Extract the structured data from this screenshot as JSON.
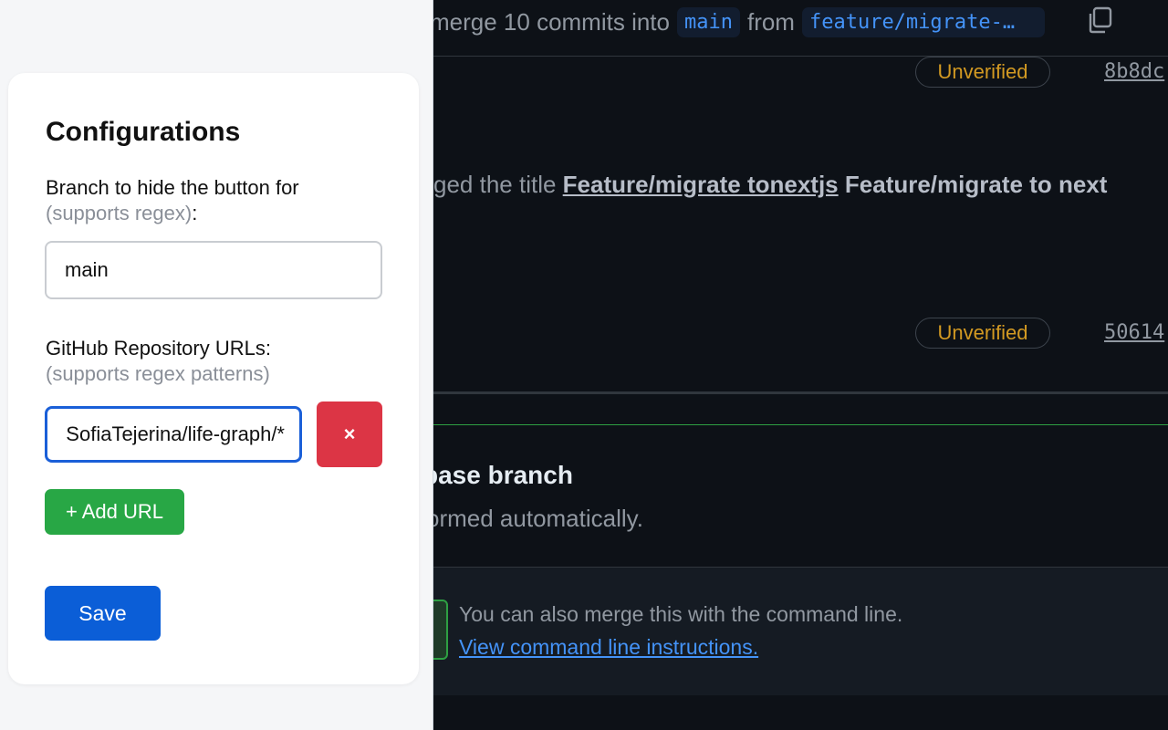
{
  "github": {
    "merge_header": {
      "lead": "merge 10 commits into",
      "base_branch": "main",
      "from_word": "from",
      "head_branch": "feature/migrate-…"
    },
    "commits": [
      {
        "status": "Unverified",
        "sha": "8b8dc"
      },
      {
        "status": "Unverified",
        "sha": "50614"
      }
    ],
    "title_change": {
      "prefix": "ged the title",
      "old_title": "Feature/migrate tonextjs",
      "new_title": "Feature/migrate to next"
    },
    "merge_box": {
      "title": "base branch",
      "subtitle": "ormed automatically.",
      "cli_text": "You can also merge this with the command line.",
      "cli_link": "View command line instructions."
    },
    "colors": {
      "accent_blue": "#4493f8",
      "unverified": "#d29922",
      "merge_green": "#2ea043"
    }
  },
  "panel": {
    "title": "Configurations",
    "branch_label": "Branch to hide the button for",
    "branch_hint": "(supports regex)",
    "branch_hint_suffix": ":",
    "branch_value": "main",
    "urls_label": "GitHub Repository URLs:",
    "urls_hint": "(supports regex patterns)",
    "url_value": "SofiaTejerina/life-graph/*",
    "remove_label": "×",
    "add_url_label": "+ Add URL",
    "save_label": "Save",
    "colors": {
      "remove": "#dc3545",
      "add": "#28a745",
      "save": "#0b5ed7"
    }
  }
}
